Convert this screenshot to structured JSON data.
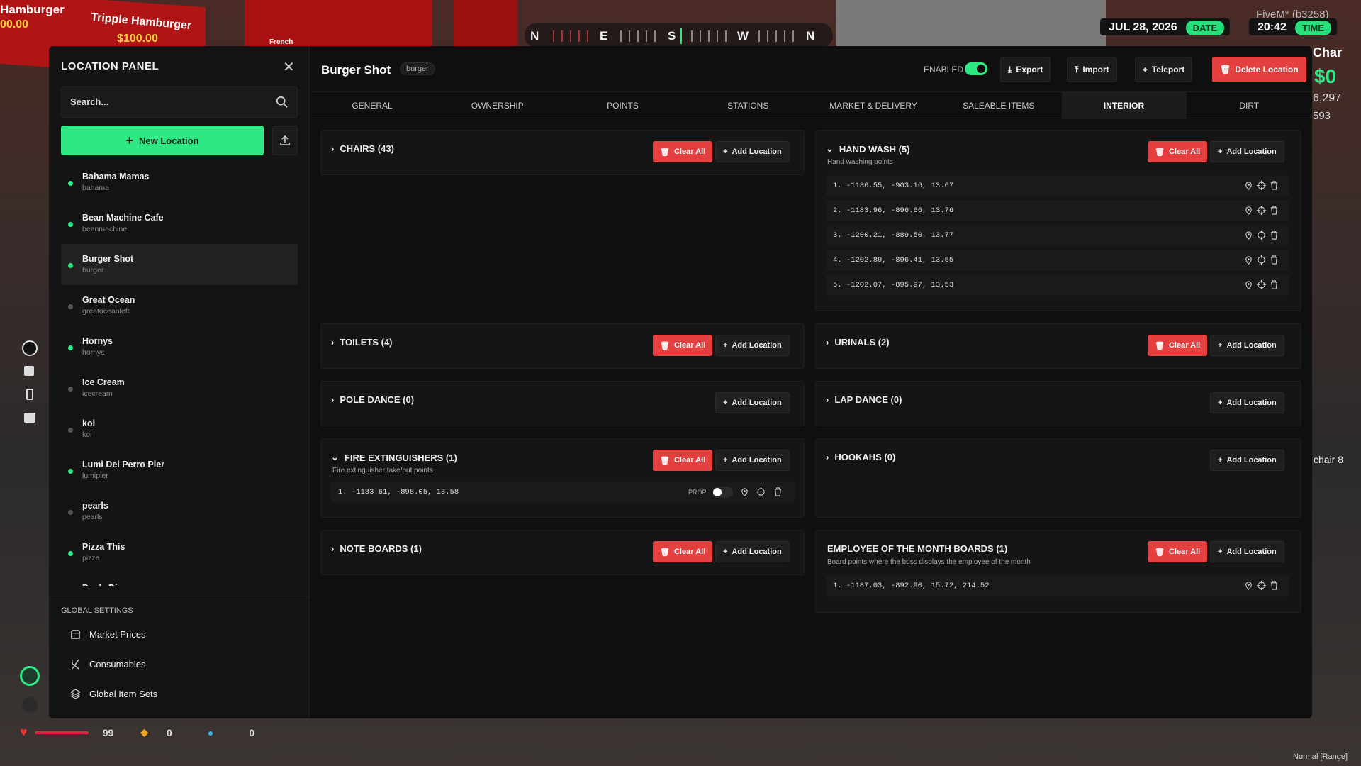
{
  "hud": {
    "date": "JUL 28, 2026",
    "date_label": "DATE",
    "time": "20:42",
    "time_label": "TIME",
    "server": "FiveM* (b3258)",
    "char_label": "Char",
    "money": "$0",
    "stat_1": "6,297",
    "stat_2": "593",
    "side_text": "chair 8",
    "compass": [
      "N",
      "E",
      "S",
      "W",
      "N"
    ],
    "bg_sign_1": "Hamburger",
    "bg_sign_2": "Tripple Hamburger",
    "bg_price_1": "00.00",
    "bg_price_2": "$100.00",
    "bg_sign_3": "French",
    "health": "99",
    "armor": "0",
    "thirst": "0",
    "mode": "Normal [Range]",
    "accent_color": "#2ee883",
    "danger_color": "#e54040"
  },
  "sidebar": {
    "title": "LOCATION PANEL",
    "search_placeholder": "Search...",
    "new_location": "New Location",
    "locations": [
      {
        "name": "Bahama Mamas",
        "slug": "bahama",
        "active": true
      },
      {
        "name": "Bean Machine Cafe",
        "slug": "beanmachine",
        "active": true
      },
      {
        "name": "Burger Shot",
        "slug": "burger",
        "active": true,
        "selected": true
      },
      {
        "name": "Great Ocean",
        "slug": "greatoceanleft",
        "active": false
      },
      {
        "name": "Hornys",
        "slug": "hornys",
        "active": true
      },
      {
        "name": "Ice Cream",
        "slug": "icecream",
        "active": false
      },
      {
        "name": "koi",
        "slug": "koi",
        "active": false
      },
      {
        "name": "Lumi Del Perro Pier",
        "slug": "lumipier",
        "active": true
      },
      {
        "name": "pearls",
        "slug": "pearls",
        "active": false
      },
      {
        "name": "Pizza This",
        "slug": "pizza",
        "active": true
      },
      {
        "name": "Pop's Dinner",
        "slug": "",
        "active": true
      }
    ],
    "global_settings_title": "GLOBAL SETTINGS",
    "global_items": [
      "Market Prices",
      "Consumables",
      "Global Item Sets"
    ]
  },
  "header": {
    "title": "Burger Shot",
    "tag": "burger",
    "enabled_label": "ENABLED",
    "export": "Export",
    "import": "Import",
    "teleport": "Teleport",
    "delete": "Delete Location"
  },
  "tabs": [
    "GENERAL",
    "OWNERSHIP",
    "POINTS",
    "STATIONS",
    "MARKET & DELIVERY",
    "SALEABLE ITEMS",
    "INTERIOR",
    "DIRT"
  ],
  "active_tab": "INTERIOR",
  "buttons": {
    "clear_all": "Clear All",
    "add_location": "Add Location",
    "prop": "PROP"
  },
  "cards": {
    "chairs": {
      "title": "CHAIRS (43)"
    },
    "hand_wash": {
      "title": "HAND WASH (5)",
      "desc": "Hand washing points",
      "points": [
        "1.  -1186.55, -903.16, 13.67",
        "2.  -1183.96, -896.66, 13.76",
        "3.  -1200.21, -889.50, 13.77",
        "4.  -1202.89, -896.41, 13.55",
        "5.  -1202.07, -895.97, 13.53"
      ]
    },
    "toilets": {
      "title": "TOILETS (4)"
    },
    "urinals": {
      "title": "URINALS (2)"
    },
    "pole_dance": {
      "title": "POLE DANCE (0)"
    },
    "lap_dance": {
      "title": "LAP DANCE (0)"
    },
    "fire_ext": {
      "title": "FIRE EXTINGUISHERS (1)",
      "desc": "Fire extinguisher take/put points",
      "points": [
        "1.  -1183.61, -898.05, 13.58"
      ]
    },
    "hookahs": {
      "title": "HOOKAHS (0)"
    },
    "note_boards": {
      "title": "NOTE BOARDS (1)"
    },
    "eotm": {
      "title": "EMPLOYEE OF THE MONTH BOARDS (1)",
      "desc": "Board points where the boss displays the employee of the month",
      "points": [
        "1.  -1187.03, -892.90, 15.72, 214.52"
      ]
    }
  }
}
